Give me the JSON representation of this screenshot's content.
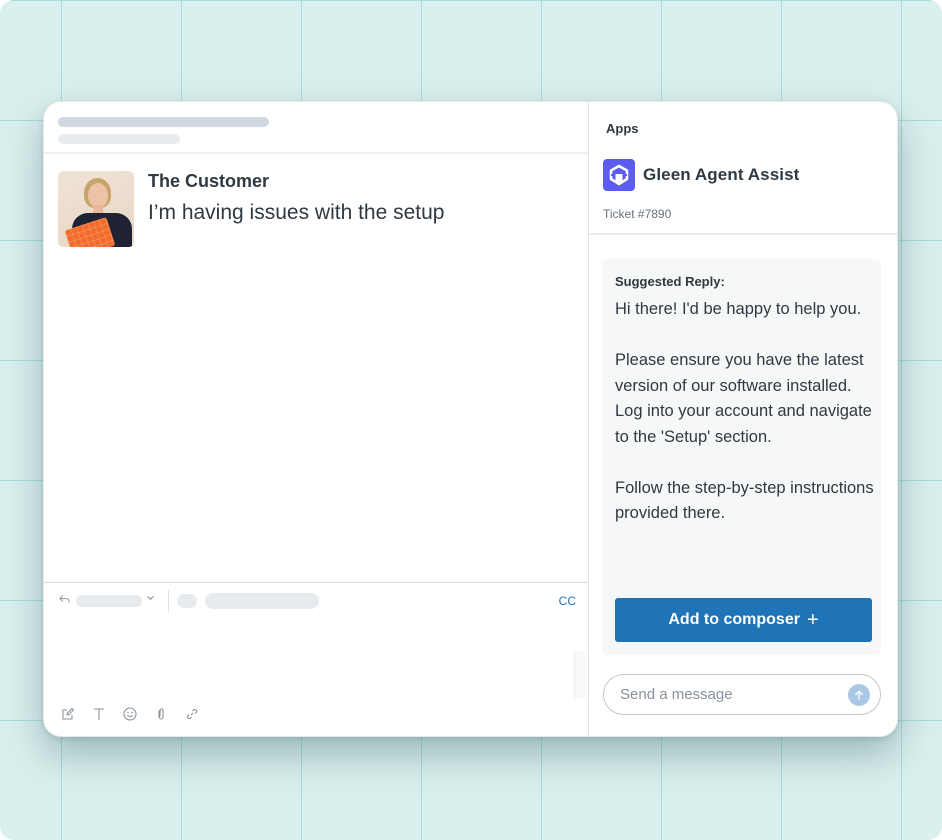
{
  "conversation": {
    "author": "The Customer",
    "message": "I’m having issues with the setup"
  },
  "composer": {
    "cc_label": "CC",
    "tools": [
      {
        "icon": "compose-icon"
      },
      {
        "icon": "text-format-icon"
      },
      {
        "icon": "emoji-icon"
      },
      {
        "icon": "attachment-icon"
      },
      {
        "icon": "link-icon"
      }
    ]
  },
  "apps_panel": {
    "section_label": "Apps",
    "app_name": "Gleen Agent Assist",
    "ticket_label": "Ticket #7890",
    "brand_color": "#5c5cf0"
  },
  "suggested_reply": {
    "label": "Suggested Reply:",
    "paragraphs": [
      "Hi there! I'd be happy to help you.",
      "Please ensure you have the latest version of our software installed. Log into your account and navigate to the 'Setup' section.",
      "Follow the step-by-step instructions provided there."
    ],
    "button_label": "Add to composer",
    "button_icon": "+",
    "button_color": "#1f73b7"
  },
  "chat_input": {
    "placeholder": "Send a message",
    "value": ""
  }
}
